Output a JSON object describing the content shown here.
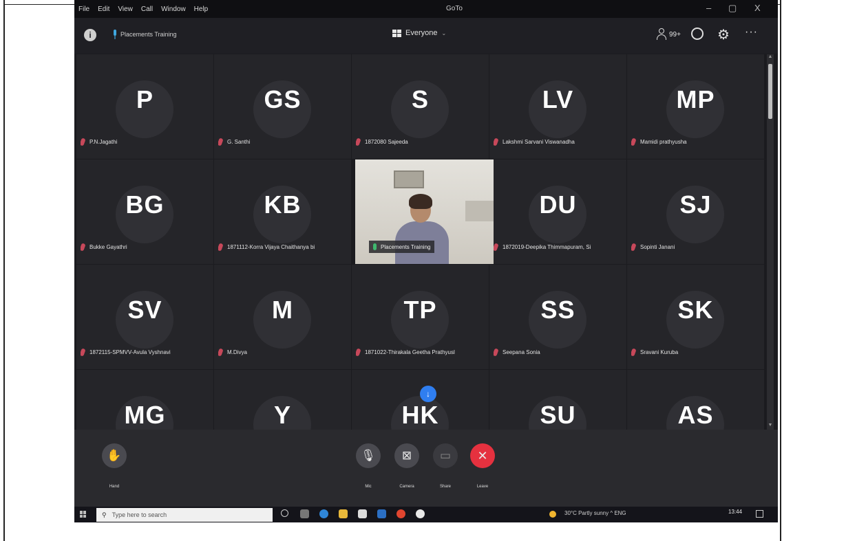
{
  "menubar": {
    "items": [
      "File",
      "Edit",
      "View",
      "Call",
      "Window",
      "Help"
    ],
    "app_title": "GoTo",
    "minimize": "–",
    "maximize": "▢",
    "close": "X"
  },
  "header": {
    "info_icon": "i",
    "meeting_name": "Placements Training",
    "view_label": "Everyone",
    "people_count": "99+"
  },
  "tiles": [
    {
      "initials": "P",
      "name": "P.N.Jagathi"
    },
    {
      "initials": "GS",
      "name": "G. Santhi"
    },
    {
      "initials": "S",
      "name": "1872080 Sajeeda"
    },
    {
      "initials": "LV",
      "name": "Lakshmi Sarvani Viswanadha"
    },
    {
      "initials": "MP",
      "name": "Mamidi prathyusha"
    },
    {
      "initials": "BG",
      "name": "Bukke Gayathri"
    },
    {
      "initials": "KB",
      "name": "1871112-Korra Vijaya Chaithanya bi"
    },
    {
      "initials": "DU",
      "name": "1872019-Deepika Thimmapuram, Si"
    },
    {
      "initials": "SJ",
      "name": "Sopinti Janani"
    },
    {
      "initials": "SV",
      "name": "1872115-SPMVV-Avula Vyshnavi"
    },
    {
      "initials": "M",
      "name": "M.Divya"
    },
    {
      "initials": "TP",
      "name": "1871022-Thirakala Geetha Prathyusl"
    },
    {
      "initials": "SS",
      "name": "Seepana Sonia"
    },
    {
      "initials": "SK",
      "name": "Sravani Kuruba"
    },
    {
      "initials": "MG",
      "name": ""
    },
    {
      "initials": "Y",
      "name": ""
    },
    {
      "initials": "HK",
      "name": ""
    },
    {
      "initials": "SU",
      "name": ""
    },
    {
      "initials": "AS",
      "name": ""
    }
  ],
  "video_tile": {
    "name": "Placements Training"
  },
  "toolbar": {
    "hand": "Hand",
    "mic": "Mic",
    "camera": "Camera",
    "share": "Share",
    "leave": "Leave"
  },
  "taskbar": {
    "search_placeholder": "Type here to search",
    "tray_text": "30°C  Partly sunny  ^  ENG",
    "clock": "13:44"
  },
  "colors": {
    "background": "#1b1b1f",
    "tile": "#252529",
    "muted_mic": "#c7485a",
    "live_mic": "#3fb86e",
    "leave": "#e5313f",
    "accent": "#2f7ef0"
  }
}
